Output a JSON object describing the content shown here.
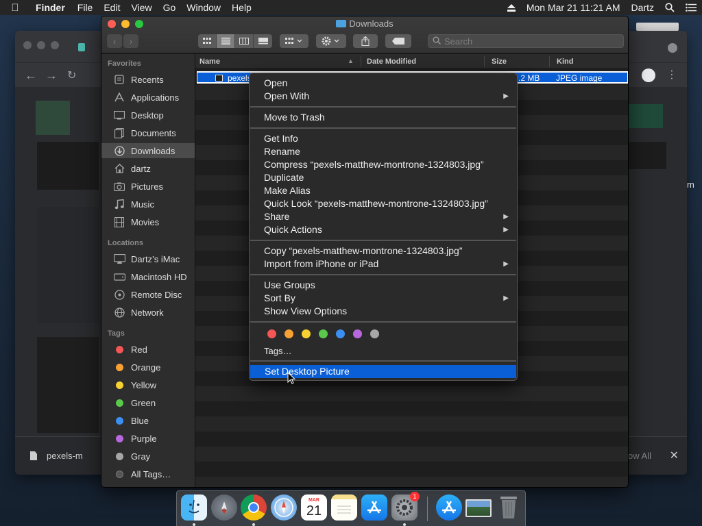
{
  "menubar": {
    "app_name": "Finder",
    "menus": [
      "File",
      "Edit",
      "View",
      "Go",
      "Window",
      "Help"
    ],
    "datetime": "Mon Mar 21  11:21 AM",
    "user": "Dartz"
  },
  "browser": {
    "download_file": "pexels-m",
    "show_all": "ow All",
    "side_char": "m"
  },
  "finder": {
    "title": "Downloads",
    "search_placeholder": "Search",
    "sidebar": {
      "favorites_header": "Favorites",
      "favorites": [
        {
          "label": "Recents",
          "icon": "recents-icon"
        },
        {
          "label": "Applications",
          "icon": "applications-icon"
        },
        {
          "label": "Desktop",
          "icon": "desktop-icon"
        },
        {
          "label": "Documents",
          "icon": "documents-icon"
        },
        {
          "label": "Downloads",
          "icon": "downloads-icon"
        },
        {
          "label": "dartz",
          "icon": "home-icon"
        },
        {
          "label": "Pictures",
          "icon": "pictures-icon"
        },
        {
          "label": "Music",
          "icon": "music-icon"
        },
        {
          "label": "Movies",
          "icon": "movies-icon"
        }
      ],
      "locations_header": "Locations",
      "locations": [
        {
          "label": "Dartz’s iMac",
          "icon": "imac-icon"
        },
        {
          "label": "Macintosh HD",
          "icon": "hard-disk-icon"
        },
        {
          "label": "Remote Disc",
          "icon": "disc-icon"
        },
        {
          "label": "Network",
          "icon": "network-icon"
        }
      ],
      "tags_header": "Tags",
      "tags": [
        {
          "label": "Red",
          "color": "#f25756"
        },
        {
          "label": "Orange",
          "color": "#f7a034"
        },
        {
          "label": "Yellow",
          "color": "#f7d131"
        },
        {
          "label": "Green",
          "color": "#5ac84a"
        },
        {
          "label": "Blue",
          "color": "#3b8ff2"
        },
        {
          "label": "Purple",
          "color": "#b868df"
        },
        {
          "label": "Gray",
          "color": "#a7a7a7"
        },
        {
          "label": "All Tags…",
          "color": "#555555"
        }
      ]
    },
    "columns": {
      "name": "Name",
      "date_modified": "Date Modified",
      "size": "Size",
      "kind": "Kind"
    },
    "selected_file": {
      "name": "pexels",
      "size": ".2 MB",
      "kind": "JPEG image"
    }
  },
  "context_menu": {
    "items": [
      {
        "label": "Open",
        "submenu": false
      },
      {
        "label": "Open With",
        "submenu": true
      },
      {
        "label": "Move to Trash",
        "submenu": false
      },
      {
        "label": "Get Info",
        "submenu": false
      },
      {
        "label": "Rename",
        "submenu": false
      },
      {
        "label": "Compress “pexels-matthew-montrone-1324803.jpg”",
        "submenu": false
      },
      {
        "label": "Duplicate",
        "submenu": false
      },
      {
        "label": "Make Alias",
        "submenu": false
      },
      {
        "label": "Quick Look “pexels-matthew-montrone-1324803.jpg”",
        "submenu": false
      },
      {
        "label": "Share",
        "submenu": true
      },
      {
        "label": "Quick Actions",
        "submenu": true
      },
      {
        "label": "Copy “pexels-matthew-montrone-1324803.jpg”",
        "submenu": false
      },
      {
        "label": "Import from iPhone or iPad",
        "submenu": true
      },
      {
        "label": "Use Groups",
        "submenu": false
      },
      {
        "label": "Sort By",
        "submenu": true
      },
      {
        "label": "Show View Options",
        "submenu": false
      },
      {
        "label": "Tags…",
        "submenu": false
      },
      {
        "label": "Set Desktop Picture",
        "submenu": false,
        "highlighted": true
      }
    ],
    "tag_colors": [
      "#f25756",
      "#f7a034",
      "#f7d131",
      "#5ac84a",
      "#3b8ff2",
      "#b868df",
      "#a7a7a7"
    ]
  },
  "dock": {
    "calendar_month": "MAR",
    "calendar_day": "21",
    "settings_badge": "1",
    "apps": [
      "finder-icon",
      "launchpad-icon",
      "chrome-icon",
      "safari-icon",
      "calendar-icon",
      "notes-icon",
      "app-store-icon",
      "system-preferences-icon",
      "app-store-download-icon",
      "photo-icon",
      "trash-icon"
    ]
  }
}
